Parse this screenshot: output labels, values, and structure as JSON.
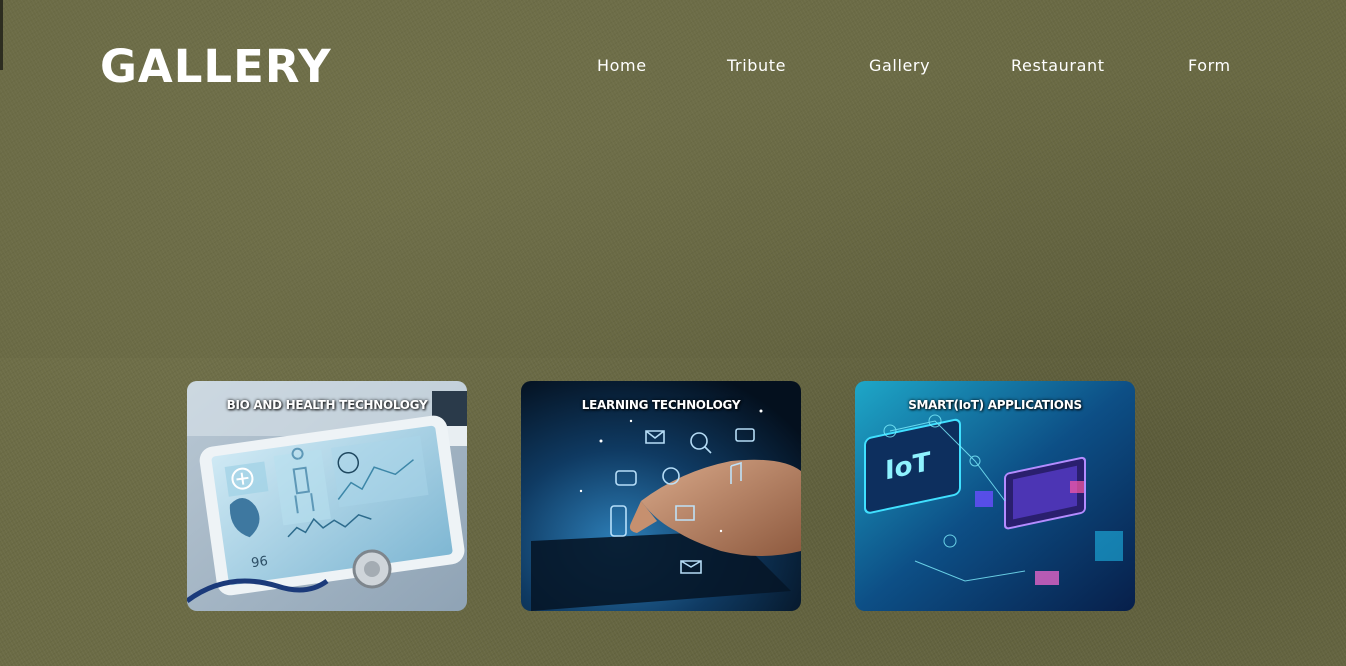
{
  "header": {
    "logo_text": "GALLERY"
  },
  "nav": {
    "items": [
      {
        "label": "Home"
      },
      {
        "label": "Tribute"
      },
      {
        "label": "Gallery"
      },
      {
        "label": "Restaurant"
      },
      {
        "label": "Form"
      }
    ]
  },
  "gallery": {
    "cards": [
      {
        "title": "BIO AND HEALTH TECHNOLOGY",
        "image_subject": "medical-tablet-heart-scan",
        "overlay_value": "96"
      },
      {
        "title": "LEARNING TECHNOLOGY",
        "image_subject": "hand-touching-tablet-with-floating-icons"
      },
      {
        "title": "SMART(IoT) APPLICATIONS",
        "image_subject": "isometric-iot-network",
        "overlay_text": "IoT"
      }
    ]
  },
  "colors": {
    "background": "#6b6b45",
    "text": "#ffffff"
  }
}
